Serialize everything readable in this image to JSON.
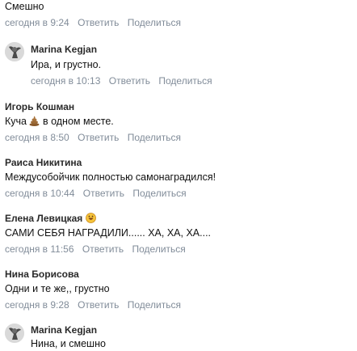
{
  "actions": {
    "reply": "Ответить",
    "share": "Поделиться"
  },
  "comments": [
    {
      "text": "Смешно",
      "time": "сегодня в 9:24"
    },
    {
      "author": "Marina Kegjan",
      "text": "Ира, и грустно.",
      "time": "сегодня в 10:13"
    },
    {
      "author": "Игорь Кошман",
      "text_before": "Куча",
      "emoji": "poop-emoji",
      "text_after": "в одном месте.",
      "time": "сегодня в 8:50"
    },
    {
      "author": "Раиса Никитина",
      "text": "Междусобойчик полностью самонаградился!",
      "time": "сегодня в 10:44"
    },
    {
      "author": "Елена Левицкая",
      "emoji": "smiling-face-emoji",
      "text": "САМИ СЕБЯ НАГРАДИЛИ...... ХА, ХА, ХА....",
      "time": "сегодня в 11:56"
    },
    {
      "author": "Нина Борисова",
      "text": "Одни и те же,, грустно",
      "time": "сегодня в 9:28"
    },
    {
      "author": "Marina Kegjan",
      "text": "Нина, и смешно"
    }
  ]
}
